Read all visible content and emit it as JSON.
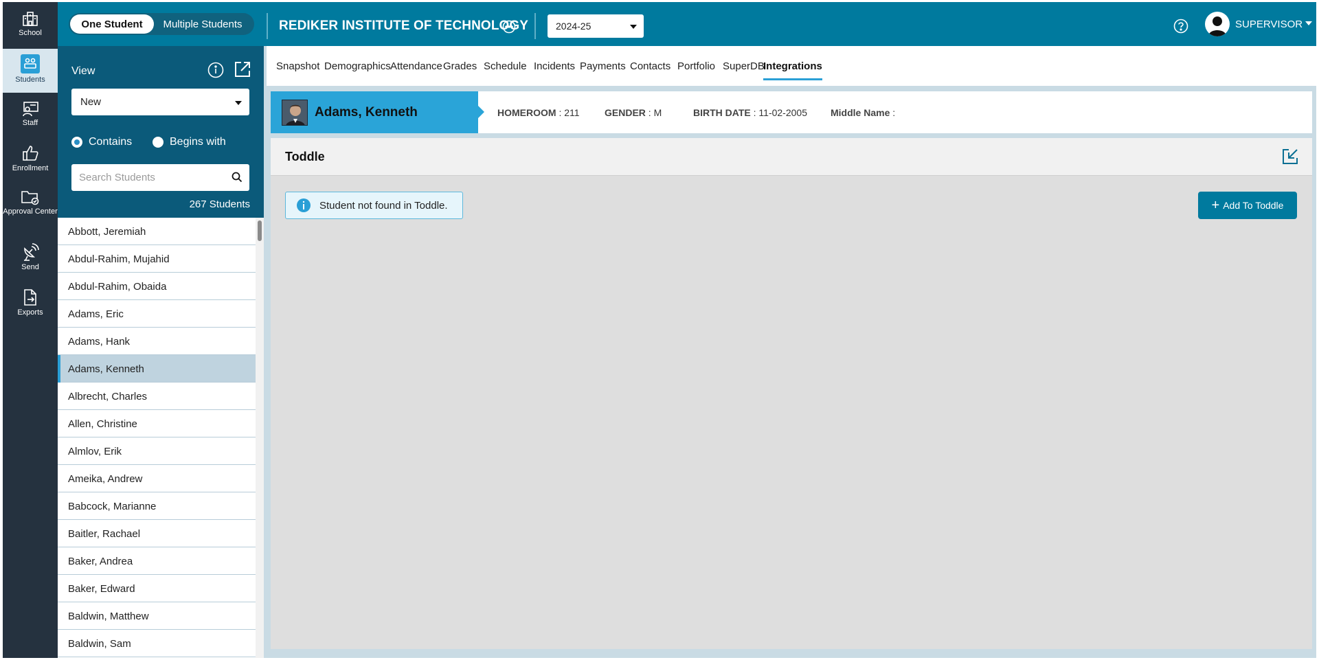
{
  "rail": {
    "items": [
      {
        "label": "School",
        "icon": "school-icon"
      },
      {
        "label": "Students",
        "icon": "students-icon"
      },
      {
        "label": "Staff",
        "icon": "staff-icon"
      },
      {
        "label": "Enrollment",
        "icon": "thumbs-up-icon"
      },
      {
        "label": "Approval Center",
        "icon": "folder-check-icon"
      },
      {
        "label": "Send",
        "icon": "satellite-dish-icon"
      },
      {
        "label": "Exports",
        "icon": "export-file-icon"
      }
    ]
  },
  "topbar": {
    "mode_one": "One Student",
    "mode_multi": "Multiple Students",
    "school_name": "REDIKER INSTITUTE OF TECHNOLOGY",
    "year": "2024-25",
    "user": "SUPERVISOR",
    "accent": "#007a9e"
  },
  "panel": {
    "view_label": "View",
    "view_value": "New",
    "radio_contains": "Contains",
    "radio_begins": "Begins with",
    "search_placeholder": "Search Students",
    "count": "267 Students"
  },
  "students": [
    "Abbott, Jeremiah",
    "Abdul-Rahim, Mujahid",
    "Abdul-Rahim, Obaida",
    "Adams, Eric",
    "Adams, Hank",
    "Adams, Kenneth",
    "Albrecht, Charles",
    "Allen, Christine",
    "Almlov, Erik",
    "Ameika, Andrew",
    "Babcock, Marianne",
    "Baitler, Rachael",
    "Baker, Andrea",
    "Baker, Edward",
    "Baldwin, Matthew",
    "Baldwin, Sam"
  ],
  "selected_student_index": 5,
  "tabs": [
    "Snapshot",
    "Demographics",
    "Attendance",
    "Grades",
    "Schedule",
    "Incidents",
    "Payments",
    "Contacts",
    "Portfolio",
    "SuperDB",
    "Integrations"
  ],
  "active_tab": "Integrations",
  "student": {
    "name": "Adams, Kenneth",
    "homeroom_label": "HOMEROOM",
    "homeroom_value": ": 211",
    "gender_label": "GENDER",
    "gender_value": ": M",
    "birth_label": "BIRTH DATE",
    "birth_value": ": 11-02-2005",
    "middle_label": "Middle Name",
    "middle_value": ":"
  },
  "card": {
    "title": "Toddle",
    "alert": "Student not found in Toddle.",
    "add_button": "Add To Toddle"
  }
}
